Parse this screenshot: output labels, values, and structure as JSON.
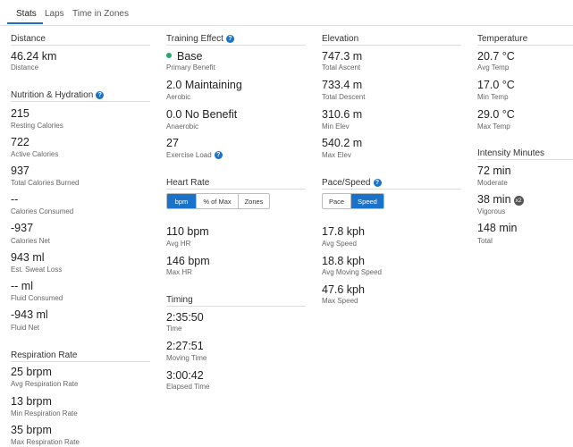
{
  "tabs": [
    "Stats",
    "Laps",
    "Time in Zones"
  ],
  "distance": {
    "title": "Distance",
    "value": "46.24 km",
    "label": "Distance"
  },
  "nutrition": {
    "title": "Nutrition & Hydration",
    "items": [
      {
        "value": "215",
        "label": "Resting Calories"
      },
      {
        "value": "722",
        "label": "Active Calories"
      },
      {
        "value": "937",
        "label": "Total Calories Burned"
      },
      {
        "value": "--",
        "label": "Calories Consumed"
      },
      {
        "value": "-937",
        "label": "Calories Net"
      },
      {
        "value": "943 ml",
        "label": "Est. Sweat Loss"
      },
      {
        "value": "-- ml",
        "label": "Fluid Consumed"
      },
      {
        "value": "-943 ml",
        "label": "Fluid Net"
      }
    ]
  },
  "respiration": {
    "title": "Respiration Rate",
    "items": [
      {
        "value": "25 brpm",
        "label": "Avg Respiration Rate"
      },
      {
        "value": "13 brpm",
        "label": "Min Respiration Rate"
      },
      {
        "value": "35 brpm",
        "label": "Max Respiration Rate"
      }
    ]
  },
  "training": {
    "title": "Training Effect",
    "items": [
      {
        "value": "Base",
        "label": "Primary Benefit"
      },
      {
        "value": "2.0 Maintaining",
        "label": "Aerobic"
      },
      {
        "value": "0.0 No Benefit",
        "label": "Anaerobic"
      },
      {
        "value": "27",
        "label": "Exercise Load"
      }
    ]
  },
  "heart_rate": {
    "title": "Heart Rate",
    "toggle": [
      "bpm",
      "% of Max",
      "Zones"
    ],
    "items": [
      {
        "value": "110 bpm",
        "label": "Avg HR"
      },
      {
        "value": "146 bpm",
        "label": "Max HR"
      }
    ]
  },
  "timing": {
    "title": "Timing",
    "items": [
      {
        "value": "2:35:50",
        "label": "Time"
      },
      {
        "value": "2:27:51",
        "label": "Moving Time"
      },
      {
        "value": "3:00:42",
        "label": "Elapsed Time"
      }
    ]
  },
  "elevation": {
    "title": "Elevation",
    "items": [
      {
        "value": "747.3 m",
        "label": "Total Ascent"
      },
      {
        "value": "733.4 m",
        "label": "Total Descent"
      },
      {
        "value": "310.6 m",
        "label": "Min Elev"
      },
      {
        "value": "540.2 m",
        "label": "Max Elev"
      }
    ]
  },
  "pace_speed": {
    "title": "Pace/Speed",
    "toggle": [
      "Pace",
      "Speed"
    ],
    "items": [
      {
        "value": "17.8 kph",
        "label": "Avg Speed"
      },
      {
        "value": "18.8 kph",
        "label": "Avg Moving Speed"
      },
      {
        "value": "47.6 kph",
        "label": "Max Speed"
      }
    ]
  },
  "temperature": {
    "title": "Temperature",
    "items": [
      {
        "value": "20.7 °C",
        "label": "Avg Temp"
      },
      {
        "value": "17.0 °C",
        "label": "Min Temp"
      },
      {
        "value": "29.0 °C",
        "label": "Max Temp"
      }
    ]
  },
  "intensity": {
    "title": "Intensity Minutes",
    "items": [
      {
        "value": "72 min",
        "label": "Moderate"
      },
      {
        "value": "38 min",
        "label": "Vigorous",
        "badge": "x2"
      },
      {
        "value": "148 min",
        "label": "Total"
      }
    ]
  },
  "colors": {
    "accent": "#1a73c9",
    "benefit_dot": "#25a76d"
  }
}
